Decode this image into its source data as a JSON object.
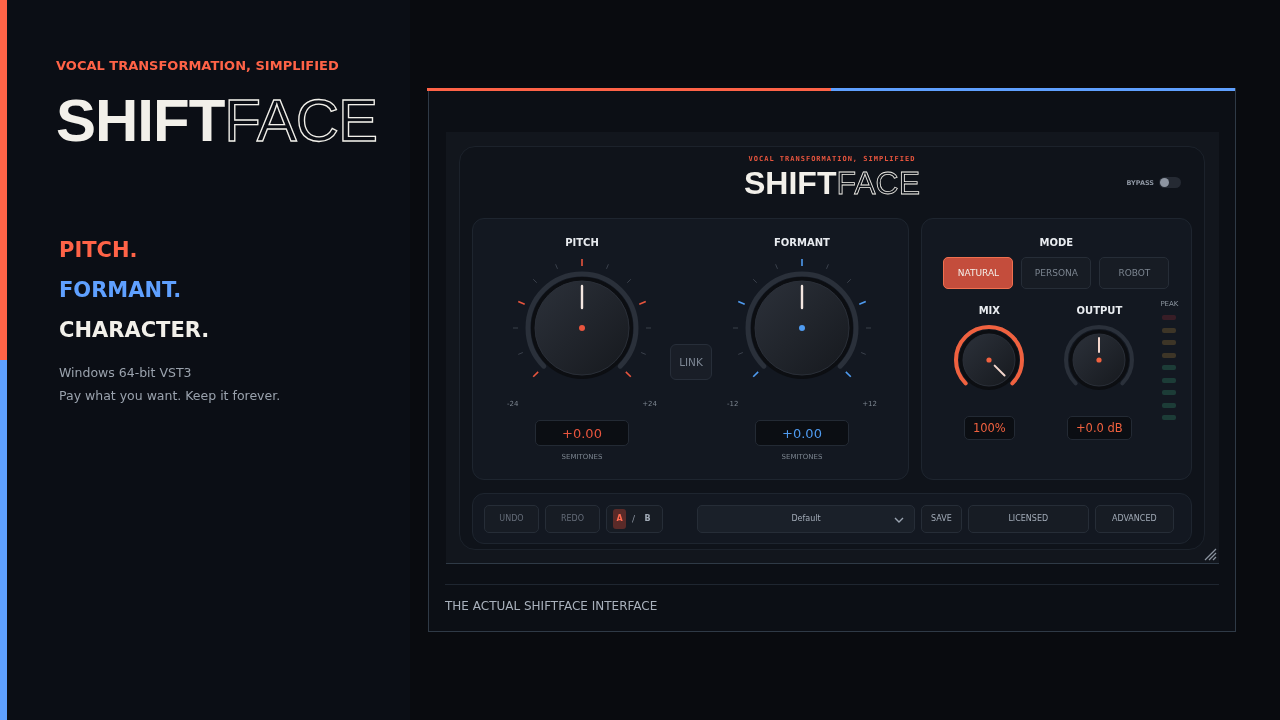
{
  "hero": {
    "tagline": "VOCAL TRANSFORMATION, SIMPLIFIED",
    "logo": {
      "solid": "SHIFT",
      "outline": "FACE"
    },
    "features": [
      {
        "text": "PITCH.",
        "color": "#ff6347"
      },
      {
        "text": "FORMANT.",
        "color": "#5fa0ff"
      },
      {
        "text": "CHARACTER.",
        "color": "#f2f0ea"
      }
    ],
    "platform": "Windows 64-bit VST3",
    "pricing": "Pay what you want. Keep it forever."
  },
  "plugin": {
    "tagline": "VOCAL TRANSFORMATION, SIMPLIFIED",
    "logo": {
      "solid": "SHIFT",
      "outline": "FACE"
    },
    "bypass": {
      "label": "BYPASS",
      "on": false
    },
    "knobs": [
      {
        "label": "PITCH",
        "min": "-24",
        "max": "+24",
        "value": "+0.00",
        "unit": "SEMITONES",
        "color": "#e8553e"
      },
      {
        "label": "FORMANT",
        "min": "-12",
        "max": "+12",
        "value": "+0.00",
        "unit": "SEMITONES",
        "color": "#4f9bf0"
      }
    ],
    "link": {
      "label": "LINK",
      "on": false
    },
    "mode": {
      "label": "MODE",
      "options": [
        {
          "label": "NATURAL",
          "selected": true
        },
        {
          "label": "PERSONA",
          "selected": false
        },
        {
          "label": "ROBOT",
          "selected": false
        }
      ]
    },
    "small_knobs": [
      {
        "label": "MIX",
        "value": "100%",
        "level": 1
      },
      {
        "label": "OUTPUT",
        "value": "+0.0 dB"
      }
    ],
    "meter": {
      "label": "PEAK"
    },
    "toolbar": {
      "undo": {
        "label": "UNDO",
        "disabled": true
      },
      "redo": {
        "label": "REDO",
        "disabled": true
      },
      "ab": [
        {
          "label": "A",
          "selected": true
        },
        {
          "label": "B",
          "selected": false
        }
      ],
      "ab_separator": "/",
      "preset": "Default",
      "save": "SAVE",
      "license": "LICENSED",
      "advanced": "ADVANCED"
    }
  },
  "caption": "THE ACTUAL SHIFTFACE INTERFACE"
}
